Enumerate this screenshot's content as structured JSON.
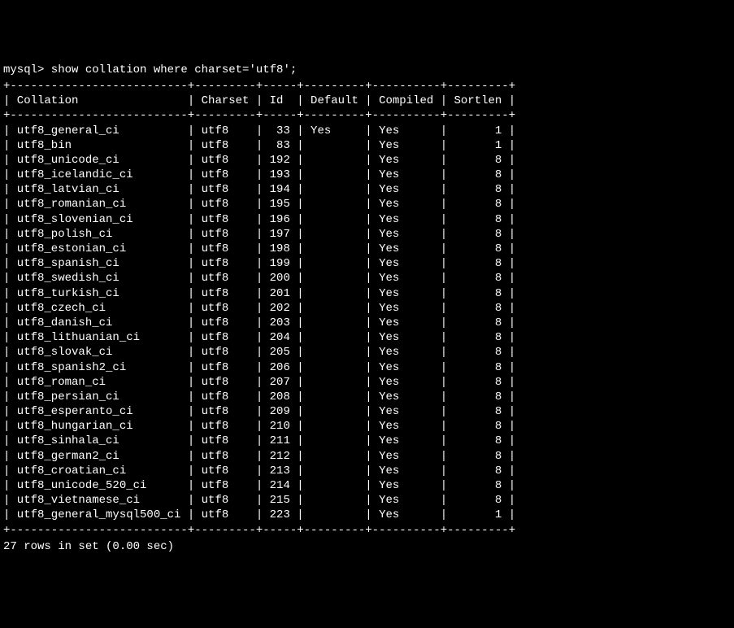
{
  "prompt": "mysql> show collation where charset='utf8';",
  "separator": "+--------------------------+---------+-----+---------+----------+---------+",
  "headers": {
    "collation": "Collation",
    "charset": "Charset",
    "id": "Id",
    "default": "Default",
    "compiled": "Compiled",
    "sortlen": "Sortlen"
  },
  "rows": [
    {
      "collation": "utf8_general_ci",
      "charset": "utf8",
      "id": "33",
      "default": "Yes",
      "compiled": "Yes",
      "sortlen": "1"
    },
    {
      "collation": "utf8_bin",
      "charset": "utf8",
      "id": "83",
      "default": "",
      "compiled": "Yes",
      "sortlen": "1"
    },
    {
      "collation": "utf8_unicode_ci",
      "charset": "utf8",
      "id": "192",
      "default": "",
      "compiled": "Yes",
      "sortlen": "8"
    },
    {
      "collation": "utf8_icelandic_ci",
      "charset": "utf8",
      "id": "193",
      "default": "",
      "compiled": "Yes",
      "sortlen": "8"
    },
    {
      "collation": "utf8_latvian_ci",
      "charset": "utf8",
      "id": "194",
      "default": "",
      "compiled": "Yes",
      "sortlen": "8"
    },
    {
      "collation": "utf8_romanian_ci",
      "charset": "utf8",
      "id": "195",
      "default": "",
      "compiled": "Yes",
      "sortlen": "8"
    },
    {
      "collation": "utf8_slovenian_ci",
      "charset": "utf8",
      "id": "196",
      "default": "",
      "compiled": "Yes",
      "sortlen": "8"
    },
    {
      "collation": "utf8_polish_ci",
      "charset": "utf8",
      "id": "197",
      "default": "",
      "compiled": "Yes",
      "sortlen": "8"
    },
    {
      "collation": "utf8_estonian_ci",
      "charset": "utf8",
      "id": "198",
      "default": "",
      "compiled": "Yes",
      "sortlen": "8"
    },
    {
      "collation": "utf8_spanish_ci",
      "charset": "utf8",
      "id": "199",
      "default": "",
      "compiled": "Yes",
      "sortlen": "8"
    },
    {
      "collation": "utf8_swedish_ci",
      "charset": "utf8",
      "id": "200",
      "default": "",
      "compiled": "Yes",
      "sortlen": "8"
    },
    {
      "collation": "utf8_turkish_ci",
      "charset": "utf8",
      "id": "201",
      "default": "",
      "compiled": "Yes",
      "sortlen": "8"
    },
    {
      "collation": "utf8_czech_ci",
      "charset": "utf8",
      "id": "202",
      "default": "",
      "compiled": "Yes",
      "sortlen": "8"
    },
    {
      "collation": "utf8_danish_ci",
      "charset": "utf8",
      "id": "203",
      "default": "",
      "compiled": "Yes",
      "sortlen": "8"
    },
    {
      "collation": "utf8_lithuanian_ci",
      "charset": "utf8",
      "id": "204",
      "default": "",
      "compiled": "Yes",
      "sortlen": "8"
    },
    {
      "collation": "utf8_slovak_ci",
      "charset": "utf8",
      "id": "205",
      "default": "",
      "compiled": "Yes",
      "sortlen": "8"
    },
    {
      "collation": "utf8_spanish2_ci",
      "charset": "utf8",
      "id": "206",
      "default": "",
      "compiled": "Yes",
      "sortlen": "8"
    },
    {
      "collation": "utf8_roman_ci",
      "charset": "utf8",
      "id": "207",
      "default": "",
      "compiled": "Yes",
      "sortlen": "8"
    },
    {
      "collation": "utf8_persian_ci",
      "charset": "utf8",
      "id": "208",
      "default": "",
      "compiled": "Yes",
      "sortlen": "8"
    },
    {
      "collation": "utf8_esperanto_ci",
      "charset": "utf8",
      "id": "209",
      "default": "",
      "compiled": "Yes",
      "sortlen": "8"
    },
    {
      "collation": "utf8_hungarian_ci",
      "charset": "utf8",
      "id": "210",
      "default": "",
      "compiled": "Yes",
      "sortlen": "8"
    },
    {
      "collation": "utf8_sinhala_ci",
      "charset": "utf8",
      "id": "211",
      "default": "",
      "compiled": "Yes",
      "sortlen": "8"
    },
    {
      "collation": "utf8_german2_ci",
      "charset": "utf8",
      "id": "212",
      "default": "",
      "compiled": "Yes",
      "sortlen": "8"
    },
    {
      "collation": "utf8_croatian_ci",
      "charset": "utf8",
      "id": "213",
      "default": "",
      "compiled": "Yes",
      "sortlen": "8"
    },
    {
      "collation": "utf8_unicode_520_ci",
      "charset": "utf8",
      "id": "214",
      "default": "",
      "compiled": "Yes",
      "sortlen": "8"
    },
    {
      "collation": "utf8_vietnamese_ci",
      "charset": "utf8",
      "id": "215",
      "default": "",
      "compiled": "Yes",
      "sortlen": "8"
    },
    {
      "collation": "utf8_general_mysql500_ci",
      "charset": "utf8",
      "id": "223",
      "default": "",
      "compiled": "Yes",
      "sortlen": "1"
    }
  ],
  "footer": "27 rows in set (0.00 sec)"
}
